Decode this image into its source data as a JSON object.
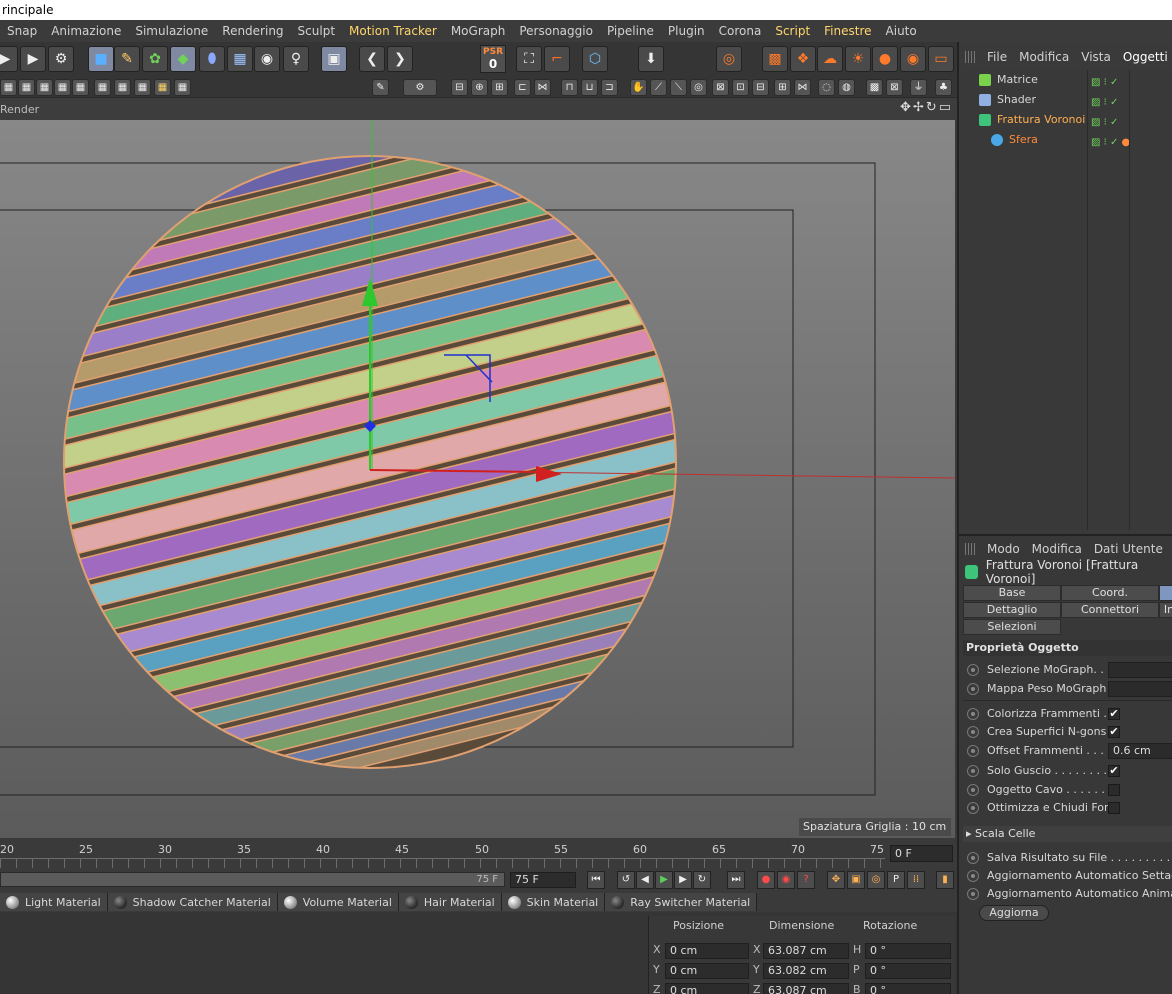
{
  "window": {
    "title": "rincipale"
  },
  "menubar": [
    {
      "label": "Snap",
      "hl": false
    },
    {
      "label": "Animazione",
      "hl": false
    },
    {
      "label": "Simulazione",
      "hl": false
    },
    {
      "label": "Rendering",
      "hl": false
    },
    {
      "label": "Sculpt",
      "hl": false
    },
    {
      "label": "Motion Tracker",
      "hl": true
    },
    {
      "label": "MoGraph",
      "hl": false
    },
    {
      "label": "Personaggio",
      "hl": false
    },
    {
      "label": "Pipeline",
      "hl": false
    },
    {
      "label": "Plugin",
      "hl": false
    },
    {
      "label": "Corona",
      "hl": false
    },
    {
      "label": "Script",
      "hl": true
    },
    {
      "label": "Finestre",
      "hl": true
    },
    {
      "label": "Aiuto",
      "hl": false
    }
  ],
  "toolbar": {
    "psr_label": "PSR",
    "psr_value": "0"
  },
  "viewport": {
    "label": "Render",
    "grid_spacing": "Spaziatura Griglia : 10 cm"
  },
  "timeline": {
    "ticks": [
      "20",
      "25",
      "30",
      "35",
      "40",
      "45",
      "50",
      "55",
      "60",
      "65",
      "70",
      "75"
    ],
    "current_frame": "0 F",
    "slider_value": "75 F",
    "end_frame": "75 F"
  },
  "materials": [
    {
      "label": "Light Material",
      "dark": false
    },
    {
      "label": "Shadow Catcher Material",
      "dark": true
    },
    {
      "label": "Volume Material",
      "dark": false
    },
    {
      "label": "Hair Material",
      "dark": true
    },
    {
      "label": "Skin Material",
      "dark": false
    },
    {
      "label": "Ray Switcher Material",
      "dark": true
    }
  ],
  "coords": {
    "headers": {
      "position": "Posizione",
      "size": "Dimensione",
      "rotation": "Rotazione"
    },
    "rows": [
      {
        "axis": "X",
        "pos": "0 cm",
        "size_axis": "X",
        "size": "63.087 cm",
        "rot_axis": "H",
        "rot": "0 °"
      },
      {
        "axis": "Y",
        "pos": "0 cm",
        "size_axis": "Y",
        "size": "63.082 cm",
        "rot_axis": "P",
        "rot": "0 °"
      },
      {
        "axis": "Z",
        "pos": "0 cm",
        "size_axis": "Z",
        "size": "63.087 cm",
        "rot_axis": "B",
        "rot": "0 °"
      }
    ]
  },
  "object_manager": {
    "menu": [
      "File",
      "Modifica",
      "Vista",
      "Oggetti"
    ],
    "objects": [
      {
        "name": "Matrice",
        "color": "#7ad14a"
      },
      {
        "name": "Shader",
        "color": "#8fb0e0"
      },
      {
        "name": "Frattura Voronoi",
        "color": "#3ec47a"
      },
      {
        "name": "Sfera",
        "color": "#4aa8e8"
      }
    ]
  },
  "attributes": {
    "menu": [
      "Modo",
      "Modifica",
      "Dati Utente"
    ],
    "title": "Frattura Voronoi [Frattura Voronoi]",
    "tabs": [
      "Base",
      "Coord.",
      "Dettaglio",
      "Connettori",
      "In",
      "Selezioni"
    ],
    "section": "Proprietà Oggetto",
    "props": [
      {
        "label": "Selezione MoGraph. . ."
      },
      {
        "label": "Mappa Peso MoGraph"
      },
      {
        "label": "Colorizza Frammenti . .",
        "checked": "✔"
      },
      {
        "label": "Crea Superfici N-gons",
        "checked": "✔"
      },
      {
        "label": "Offset Frammenti . . . .",
        "value": "0.6 cm"
      },
      {
        "label": "Solo Guscio . . . . . . . . .",
        "checked": "✔"
      },
      {
        "label": "Oggetto Cavo . . . . . . ."
      },
      {
        "label": "Ottimizza e Chiudi Fori"
      }
    ],
    "scale_section": "▸ Scala Celle",
    "save_props": [
      {
        "label": "Salva Risultato su File . . . . . . . . . . ."
      },
      {
        "label": "Aggiornamento Automatico Settaggi"
      },
      {
        "label": "Aggiornamento Automatico Animazione"
      }
    ],
    "update_button": "Aggiorna"
  }
}
